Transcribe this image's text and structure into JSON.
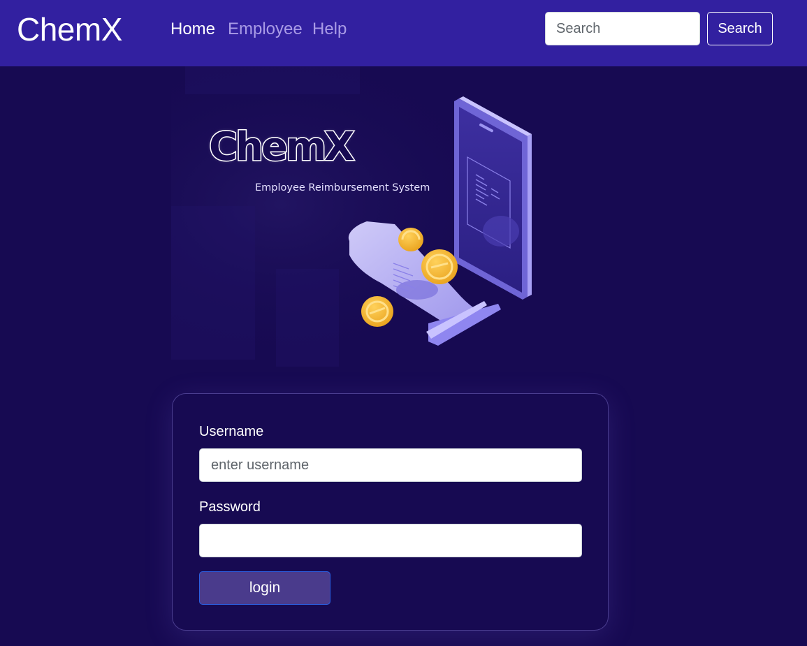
{
  "navbar": {
    "brand": "ChemX",
    "links": [
      {
        "label": "Home",
        "active": true
      },
      {
        "label": "Employee",
        "active": false
      },
      {
        "label": "Help",
        "active": false
      }
    ],
    "search": {
      "placeholder": "Search",
      "value": "",
      "button_label": "Search"
    }
  },
  "hero": {
    "logo_text": "ChemX",
    "subtitle": "Employee Reimbursement System",
    "icons": [
      "phone-illustration",
      "receipt-illustration",
      "coin-icon"
    ]
  },
  "login_form": {
    "username_label": "Username",
    "username_placeholder": "enter username",
    "username_value": "",
    "password_label": "Password",
    "password_value": "",
    "submit_label": "login"
  },
  "colors": {
    "navbar_bg": "#3220a0",
    "page_bg": "#170a52",
    "nav_inactive": "#a99be6",
    "login_button_bg": "#4a3b8c",
    "login_button_border": "#2b5fe0",
    "coin": "#f5b82e",
    "phone": "#8f86f0"
  }
}
